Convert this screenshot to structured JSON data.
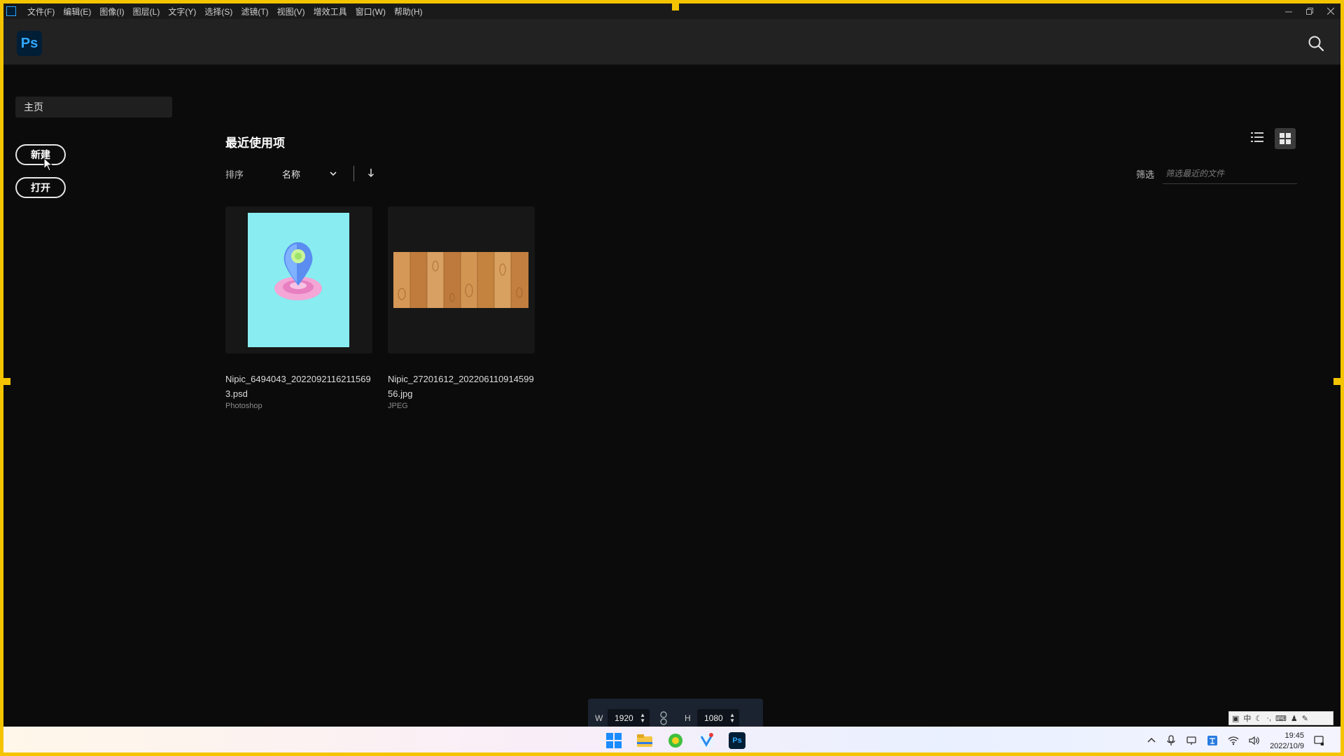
{
  "menubar": {
    "items": [
      "文件(F)",
      "编辑(E)",
      "图像(I)",
      "图层(L)",
      "文字(Y)",
      "选择(S)",
      "滤镜(T)",
      "视图(V)",
      "增效工具",
      "窗口(W)",
      "帮助(H)"
    ]
  },
  "appbar": {
    "logo": "Ps"
  },
  "sidebar": {
    "home_label": "主页",
    "new_label": "新建",
    "open_label": "打开"
  },
  "main": {
    "section_title": "最近使用项",
    "sort_label": "排序",
    "sort_value": "名称",
    "filter_label": "筛选",
    "filter_placeholder": "筛选最近的文件"
  },
  "recent_files": [
    {
      "name": "Nipic_6494043_20220921162115693.psd",
      "type": "Photoshop"
    },
    {
      "name": "Nipic_27201612_20220611091459956.jpg",
      "type": "JPEG"
    }
  ],
  "size_widget": {
    "w_label": "W",
    "w_value": "1920",
    "h_label": "H",
    "h_value": "1080"
  },
  "tray": {
    "time": "19:45",
    "date": "2022/10/9"
  },
  "ime": {
    "mode": "中"
  },
  "colors": {
    "accent_border": "#f5c400",
    "ps_blue": "#31a8ff",
    "ps_bg": "#001e36"
  }
}
